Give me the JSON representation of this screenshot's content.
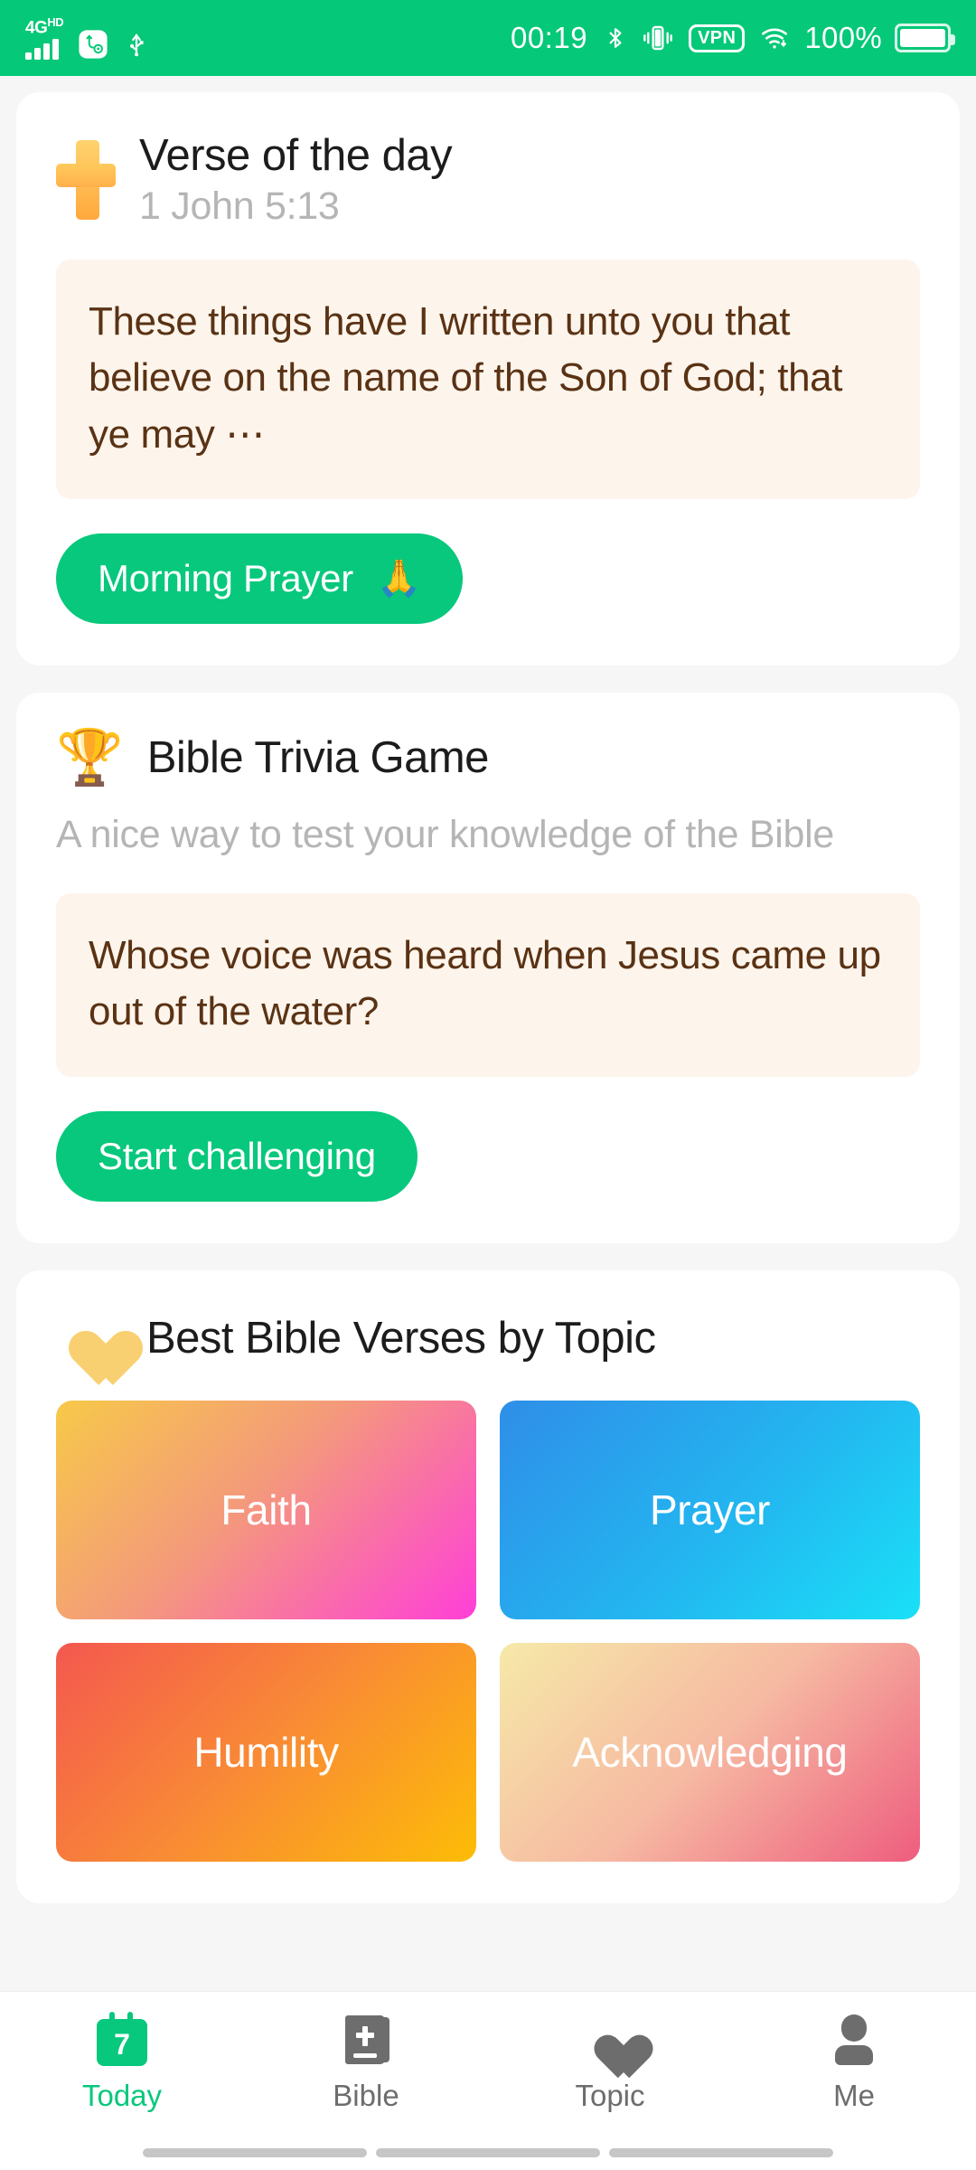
{
  "statusbar": {
    "network_label": "4G",
    "network_sup": "HD",
    "signal_icon": "signal-bars-icon",
    "usb_debug_icon": "usb-debug-icon",
    "usb_icon": "usb-icon",
    "time": "00:19",
    "bluetooth_icon": "bluetooth-icon",
    "vibrate_icon": "vibrate-icon",
    "vpn_label": "VPN",
    "wifi_icon": "wifi-icon",
    "battery_percent": "100%",
    "battery_icon": "battery-full-icon",
    "bg_color": "#05c878"
  },
  "verse_card": {
    "icon": "cross-icon",
    "title": "Verse of the day",
    "reference": "1 John 5:13",
    "verse_text": "These things have I written unto you that believe on the name of the Son of God; that ye may ⋯",
    "button_label": "Morning Prayer",
    "button_emoji": "🙏",
    "button_color": "#07c87c",
    "quote_bg": "#fdf5ec",
    "quote_text_color": "#5a3214"
  },
  "trivia_card": {
    "icon": "trophy-icon",
    "emoji": "🏆",
    "title": "Bible Trivia Game",
    "description": "A nice way to test your knowledge of the Bible",
    "question": "Whose voice was heard when Jesus came up out of the water?",
    "button_label": "Start challenging"
  },
  "topics_card": {
    "icon": "heart-icon",
    "title": "Best Bible Verses by Topic",
    "topics": [
      {
        "label": "Faith",
        "gradient": "linear-gradient(135deg,#f7c948 0%,#f49a7b 45%,#ff3fd8 100%)"
      },
      {
        "label": "Prayer",
        "gradient": "linear-gradient(135deg,#2f8ee8 0%,#23b6f0 55%,#1ae0f7 100%)"
      },
      {
        "label": "Humility",
        "gradient": "linear-gradient(135deg,#f4584f 0%,#f98b35 50%,#fdbc06 100%)"
      },
      {
        "label": "Acknowledging",
        "gradient": "linear-gradient(135deg,#f6e9a8 0%,#f6b9a2 50%,#ee5d7e 100%)"
      }
    ]
  },
  "bottom_nav": {
    "active_color": "#07c87c",
    "inactive_color": "#6d6d6d",
    "items": [
      {
        "label": "Today",
        "icon": "calendar-icon",
        "day": "7",
        "active": true
      },
      {
        "label": "Bible",
        "icon": "book-cross-icon",
        "active": false
      },
      {
        "label": "Topic",
        "icon": "heart-icon",
        "active": false
      },
      {
        "label": "Me",
        "icon": "person-icon",
        "active": false
      }
    ]
  }
}
